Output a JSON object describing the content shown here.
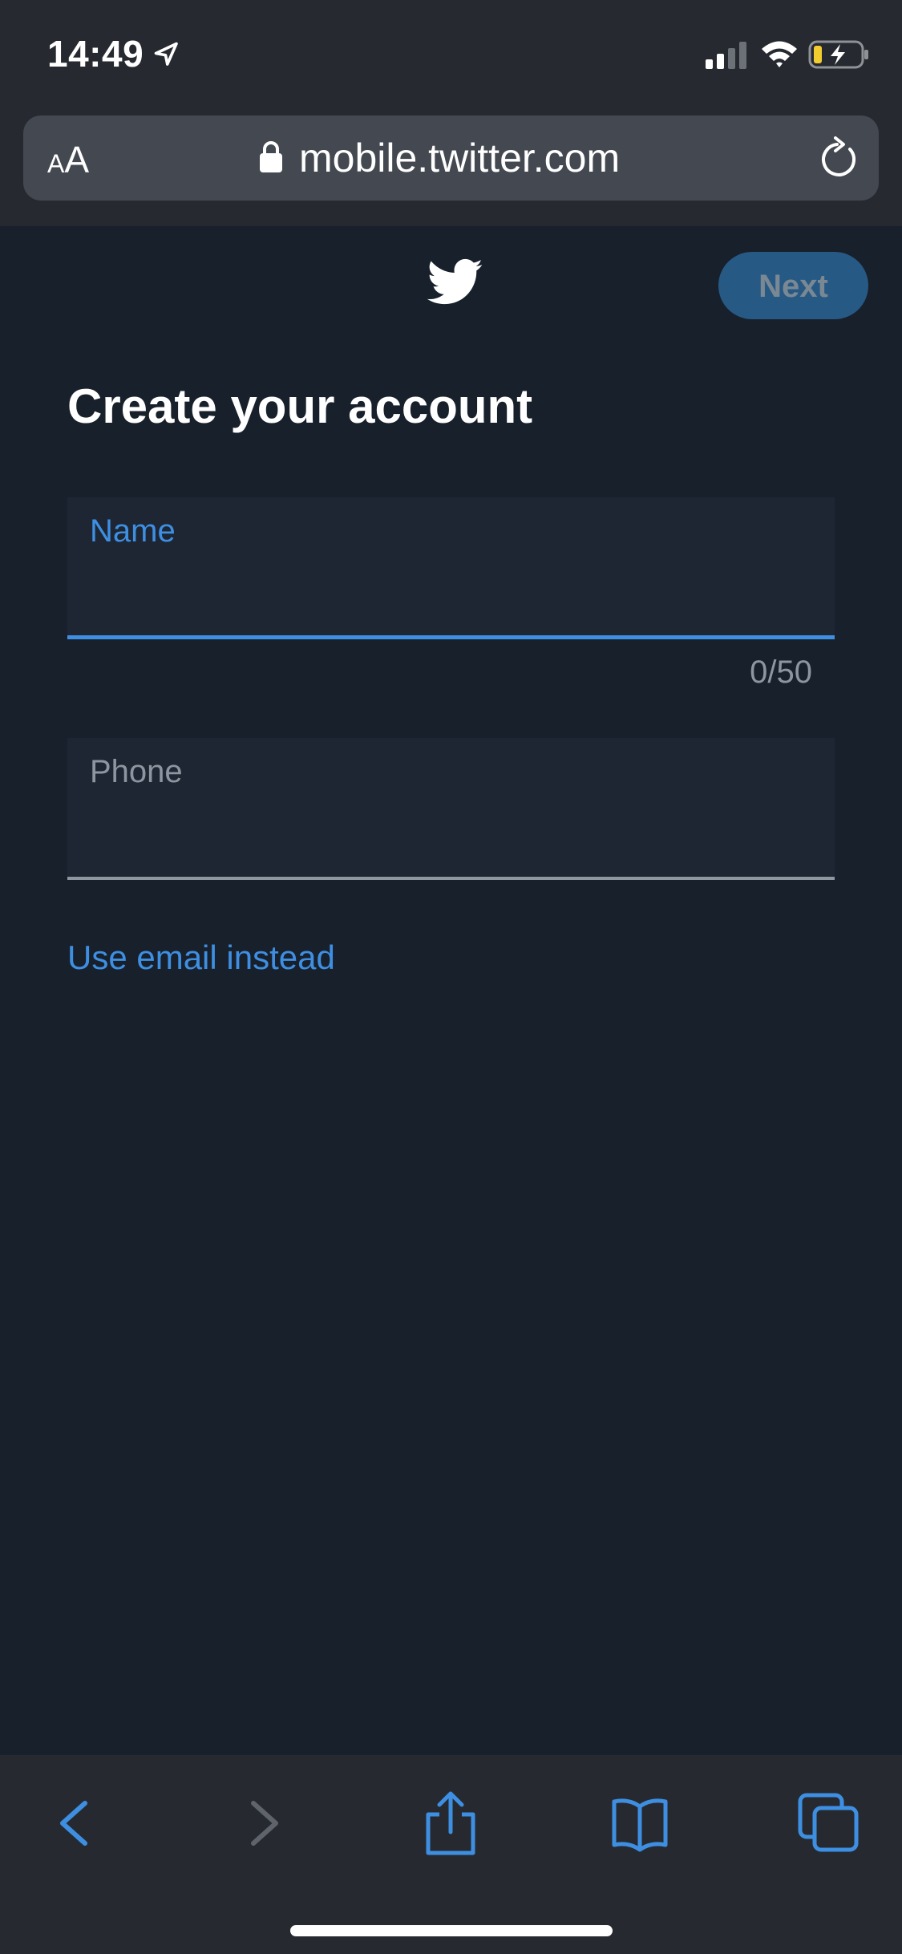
{
  "status_bar": {
    "time": "14:49",
    "icons": [
      "location-arrow-icon",
      "cellular-signal-icon",
      "wifi-icon",
      "battery-charging-icon"
    ]
  },
  "browser": {
    "text_size_small": "A",
    "text_size_big": "A",
    "url": "mobile.twitter.com",
    "icons": [
      "lock-icon",
      "reload-icon"
    ],
    "toolbar_icons": [
      "back-icon",
      "forward-icon",
      "share-icon",
      "bookmarks-icon",
      "tabs-icon"
    ]
  },
  "header": {
    "logo": "twitter-bird-icon",
    "next_label": "Next"
  },
  "form": {
    "title": "Create your account",
    "name_label": "Name",
    "name_value": "",
    "name_count": "0/50",
    "phone_label": "Phone",
    "phone_value": "",
    "use_email_label": "Use email instead"
  },
  "colors": {
    "accent": "#3e8fe2",
    "page_background": "#18202b",
    "chrome_background": "#262a30",
    "next_button_disabled": "#275985"
  }
}
